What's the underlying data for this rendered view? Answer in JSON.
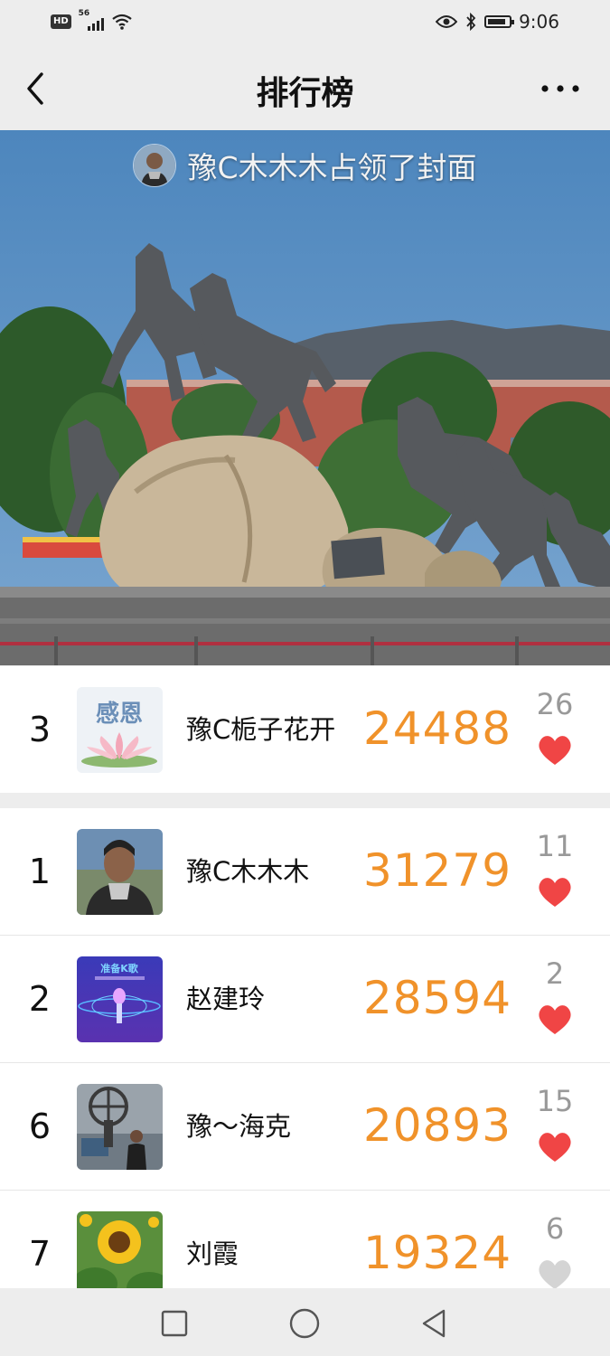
{
  "status_bar": {
    "network_badge": "HD",
    "network_type": "56",
    "time": "9:06",
    "battery_level": 0.85
  },
  "nav": {
    "title": "排行榜",
    "back_icon": "chevron-left-icon",
    "more_icon": "more-dots-icon"
  },
  "cover": {
    "caption": "豫C木木木占领了封面"
  },
  "my_entry": {
    "rank": "3",
    "name": "豫C栀子花开",
    "steps": "24488",
    "likes": "26",
    "liked": true,
    "avatar_text": "感恩"
  },
  "ranking": [
    {
      "rank": "1",
      "name": "豫C木木木",
      "steps": "31279",
      "likes": "11",
      "liked": true
    },
    {
      "rank": "2",
      "name": "赵建玲",
      "steps": "28594",
      "likes": "2",
      "liked": true,
      "avatar_text": "准备K歌"
    },
    {
      "rank": "6",
      "name": "豫～海克",
      "steps": "20893",
      "likes": "15",
      "liked": true
    },
    {
      "rank": "7",
      "name": "刘霞",
      "steps": "19324",
      "likes": "6",
      "liked": false
    }
  ],
  "colors": {
    "steps": "#f0922a",
    "heart_liked": "#f04545",
    "heart_unliked": "#d4d4d4",
    "background": "#ededed"
  },
  "bottom_nav": {
    "recent_icon": "square-icon",
    "home_icon": "circle-icon",
    "back_icon": "triangle-back-icon"
  }
}
